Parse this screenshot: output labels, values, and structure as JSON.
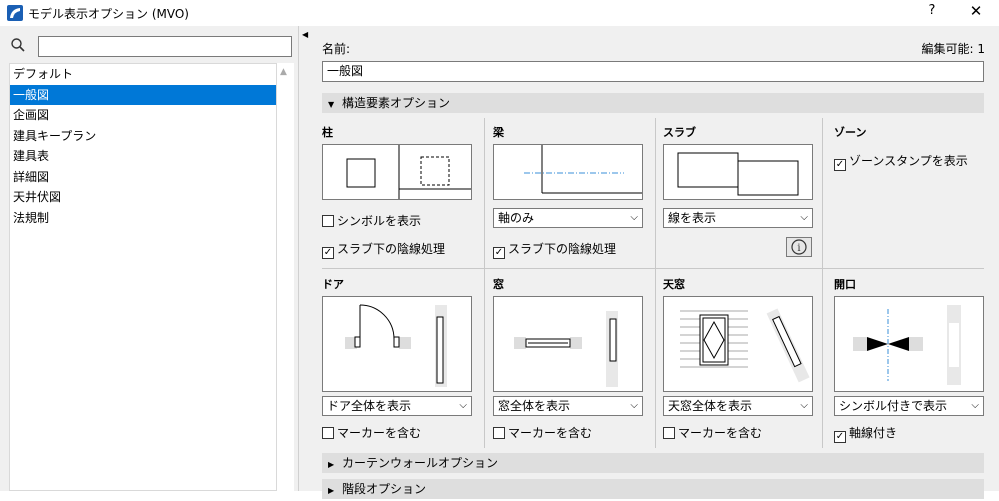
{
  "window": {
    "title": "モデル表示オプション (MVO)",
    "help": "?",
    "close": "✕"
  },
  "sidebar": {
    "search_value": "",
    "items": [
      {
        "label": "デフォルト"
      },
      {
        "label": "一般図"
      },
      {
        "label": "企画図"
      },
      {
        "label": "建具キープラン"
      },
      {
        "label": "建具表"
      },
      {
        "label": "詳細図"
      },
      {
        "label": "天井伏図"
      },
      {
        "label": "法規制"
      }
    ],
    "selected_index": 1
  },
  "main": {
    "name_label": "名前:",
    "editable": "編集可能: 1",
    "name_value": "一般図",
    "section1": "構造要素オプション",
    "section2": "カーテンウォールオプション",
    "section3": "階段オプション"
  },
  "cells": {
    "column": {
      "title": "柱",
      "show_symbol": "シンボルを表示",
      "shade_below_slab": "スラブ下の陰線処理"
    },
    "beam": {
      "title": "梁",
      "select": "軸のみ",
      "shade_below_slab": "スラブ下の陰線処理"
    },
    "slab": {
      "title": "スラブ",
      "select": "線を表示",
      "info": "i"
    },
    "zone": {
      "title": "ゾーン",
      "show_stamp": "ゾーンスタンプを表示"
    },
    "door": {
      "title": "ドア",
      "select": "ドア全体を表示",
      "marker": "マーカーを含む"
    },
    "window": {
      "title": "窓",
      "select": "窓全体を表示",
      "marker": "マーカーを含む"
    },
    "skylight": {
      "title": "天窓",
      "select": "天窓全体を表示",
      "marker": "マーカーを含む"
    },
    "opening": {
      "title": "開口",
      "select": "シンボル付きで表示",
      "axis": "軸線付き"
    }
  },
  "colors": {
    "selection": "#0078d7",
    "panel": "#f0f0f0",
    "section_bar": "#dedede",
    "axis_line": "#3a8fd9"
  }
}
